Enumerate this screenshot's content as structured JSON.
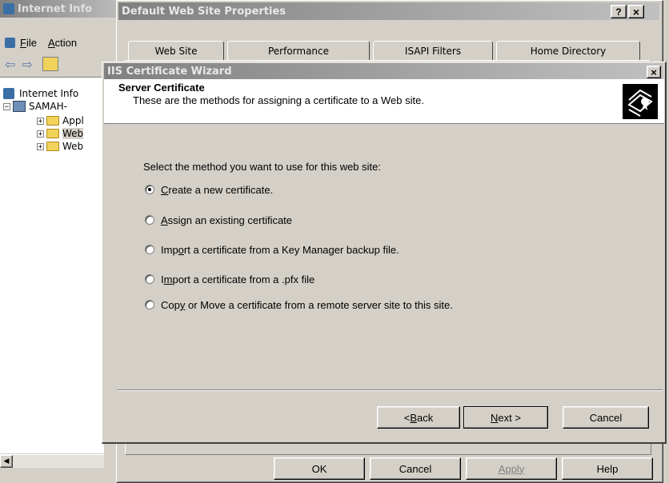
{
  "iis_window": {
    "title": "Internet Info",
    "menu": {
      "file": "File",
      "action": "Action"
    },
    "tree": {
      "root": "Internet Info",
      "server": "SAMAH-",
      "children": [
        "Appl",
        "Web",
        "Web"
      ]
    }
  },
  "properties_dialog": {
    "title": "Default Web Site Properties",
    "help_btn": "?",
    "close_btn": "×",
    "tabs": [
      "Web Site",
      "Performance",
      "ISAPI Filters",
      "Home Directory"
    ],
    "buttons": {
      "ok": "OK",
      "cancel": "Cancel",
      "apply": "Apply",
      "help": "Help"
    }
  },
  "wizard": {
    "title": "IIS Certificate Wizard",
    "close_btn": "×",
    "header_title": "Server Certificate",
    "header_desc": "These are the methods for assigning a certificate to a Web site.",
    "prompt": "Select the method you want to use for this web site:",
    "options": [
      {
        "pre": "",
        "key": "C",
        "post": "reate a new certificate.",
        "checked": true
      },
      {
        "pre": "",
        "key": "A",
        "post": "ssign an existing certificate",
        "checked": false
      },
      {
        "pre": "Imp",
        "key": "o",
        "post": "rt a certificate from a Key Manager backup file.",
        "checked": false
      },
      {
        "pre": "I",
        "key": "m",
        "post": "port a certificate from a .pfx file",
        "checked": false
      },
      {
        "pre": "Cop",
        "key": "y",
        "post": " or Move a certificate from a remote server site to this site.",
        "checked": false
      }
    ],
    "buttons": {
      "back_pre": "< ",
      "back_key": "B",
      "back_post": "ack",
      "next_key": "N",
      "next_post": "ext >",
      "cancel": "Cancel"
    }
  }
}
